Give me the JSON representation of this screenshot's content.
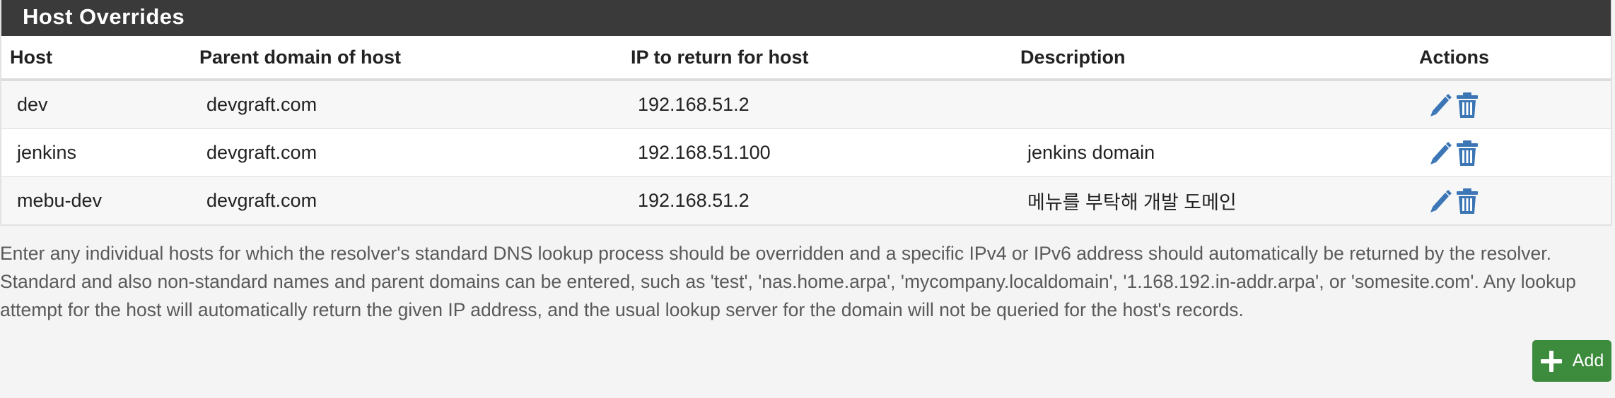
{
  "panel": {
    "title": "Host Overrides"
  },
  "table": {
    "columns": [
      "Host",
      "Parent domain of host",
      "IP to return for host",
      "Description",
      "Actions"
    ],
    "rows": [
      {
        "host": "dev",
        "domain": "devgraft.com",
        "ip": "192.168.51.2",
        "description": ""
      },
      {
        "host": "jenkins",
        "domain": "devgraft.com",
        "ip": "192.168.51.100",
        "description": "jenkins domain"
      },
      {
        "host": "mebu-dev",
        "domain": "devgraft.com",
        "ip": "192.168.51.2",
        "description": "메뉴를 부탁해 개발 도메인"
      }
    ],
    "row_actions": [
      "pencil-icon",
      "trash-icon"
    ]
  },
  "help": {
    "text": "Enter any individual hosts for which the resolver's standard DNS lookup process should be overridden and a specific IPv4 or IPv6 address should automatically be returned by the resolver. Standard and also non-standard names and parent domains can be entered, such as 'test', 'nas.home.arpa', 'mycompany.localdomain', '1.168.192.in-addr.arpa', or 'somesite.com'. Any lookup attempt for the host will automatically return the given IP address, and the usual lookup server for the domain will not be queried for the host's records."
  },
  "buttons": {
    "add_label": "Add",
    "add_icon": "plus-icon"
  },
  "colors": {
    "header_bg": "#3a3a3a",
    "icon_blue": "#3c76b5",
    "add_green": "#3d8b3d"
  }
}
